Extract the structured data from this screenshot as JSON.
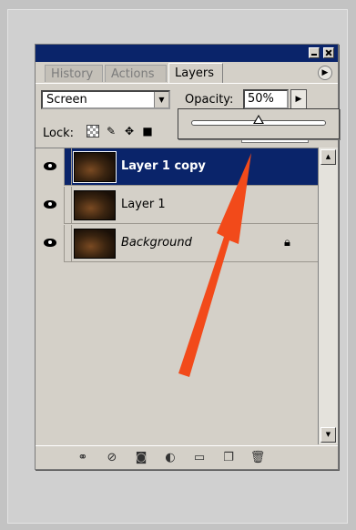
{
  "panel": {
    "tabs": [
      {
        "label": "History"
      },
      {
        "label": "Actions"
      },
      {
        "label": "Layers"
      }
    ],
    "menu_icon": "triangle-right-icon"
  },
  "controls": {
    "blend_mode": "Screen",
    "opacity_label": "Opacity:",
    "opacity_value": "50%",
    "opacity_slider_fraction": 0.5,
    "lock_label": "Lock:"
  },
  "layers": [
    {
      "name": "Layer 1 copy",
      "selected": true,
      "locked": false
    },
    {
      "name": "Layer 1",
      "selected": false,
      "locked": false
    },
    {
      "name": "Background",
      "selected": false,
      "locked": true
    }
  ],
  "bottom_icons": [
    "link-icon",
    "layer-style-icon",
    "mask-icon",
    "adjustment-icon",
    "folder-icon",
    "new-layer-icon",
    "trash-icon"
  ],
  "colors": {
    "selection": "#0a246a",
    "annotation_arrow": "#f24a1a"
  }
}
